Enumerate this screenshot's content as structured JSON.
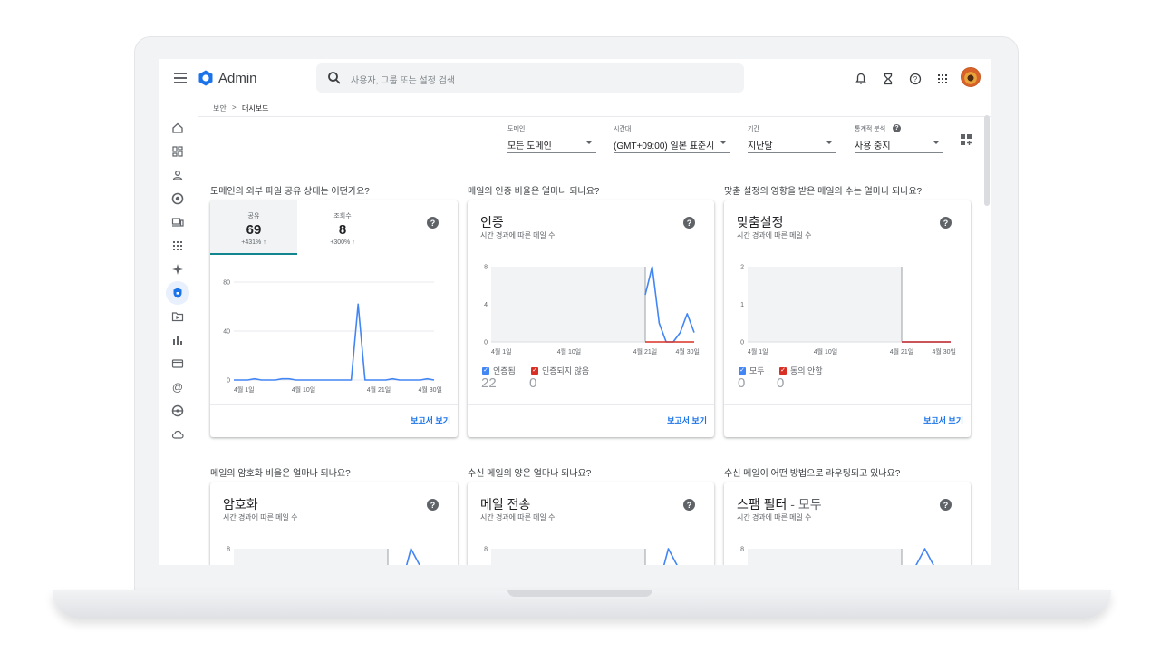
{
  "app": {
    "name": "Admin",
    "search_placeholder": "사용자, 그룹 또는 설정 검색"
  },
  "top_icons": [
    "bell-icon",
    "hourglass-icon",
    "help-icon",
    "apps-grid-icon"
  ],
  "breadcrumb": {
    "parent": "보안",
    "separator": ">",
    "current": "대시보드"
  },
  "filters": [
    {
      "label": "도메인",
      "value": "모든 도메인"
    },
    {
      "label": "시간대",
      "value": "(GMT+09:00) 일본 표준시"
    },
    {
      "label": "기간",
      "value": "지난달"
    },
    {
      "label": "통계적 분석",
      "value": "사용 중지"
    }
  ],
  "colors": {
    "accent": "#1a73e8",
    "line": "#4285f4",
    "red": "#d93025",
    "teal": "#12868f"
  },
  "cards": {
    "sharing": {
      "question": "도메인의 외부 파일 공유 상태는 어떤가요?",
      "tabs": [
        {
          "label": "공유",
          "value": "69",
          "change": "+431% ↑"
        },
        {
          "label": "조회수",
          "value": "8",
          "change": "+300% ↑"
        }
      ],
      "report_link": "보고서 보기"
    },
    "auth": {
      "question": "메일의 인증 비율은 얼마나 되나요?",
      "title": "인증",
      "subtitle": "시간 경과에 따른 메일 수",
      "legend": [
        {
          "label": "인증됨",
          "value": "22"
        },
        {
          "label": "인증되지 않음",
          "value": "0"
        }
      ],
      "report_link": "보고서 보기"
    },
    "custom": {
      "question": "맞춤 설정의 영향을 받은 메일의 수는 얼마나 되나요?",
      "title": "맞춤설정",
      "subtitle": "시간 경과에 따른 메일 수",
      "legend": [
        {
          "label": "모두",
          "value": "0"
        },
        {
          "label": "동의 안함",
          "value": "0"
        }
      ],
      "report_link": "보고서 보기"
    },
    "encryption": {
      "question": "메일의 암호화 비율은 얼마나 되나요?",
      "title": "암호화",
      "subtitle": "시간 경과에 따른 메일 수"
    },
    "volume": {
      "question": "수신 메일의 양은 얼마나 되나요?",
      "title": "메일 전송",
      "subtitle": "시간 경과에 따른 메일 수"
    },
    "routing": {
      "question": "수신 메일이 어떤 방법으로 라우팅되고 있나요?",
      "title": "스팸 필터",
      "title_suffix": " - 모두",
      "subtitle": "시간 경과에 따른 메일 수"
    }
  },
  "chart_data": [
    {
      "type": "line",
      "x": [
        "4월 1일",
        "4월 10일",
        "4월 21일",
        "4월 30일"
      ],
      "ylim": [
        0,
        80
      ],
      "yticks": [
        "0",
        "40",
        "80"
      ],
      "series": [
        {
          "values": [
            0,
            0,
            0,
            1,
            0,
            0,
            0,
            1,
            1,
            0,
            0,
            0,
            0,
            0,
            0,
            0,
            0,
            0,
            62,
            0,
            0,
            0,
            0,
            1,
            0,
            0,
            0,
            0,
            1,
            0
          ]
        }
      ]
    },
    {
      "type": "line",
      "x": [
        "4월 1일",
        "4월 10일",
        "4월 21일",
        "4월 30일"
      ],
      "ylim": [
        0,
        8
      ],
      "yticks": [
        "0",
        "4",
        "8"
      ],
      "series": [
        {
          "name": "인증됨",
          "values": [
            5,
            8,
            2,
            0,
            0,
            1,
            3,
            1
          ]
        },
        {
          "name": "인증되지 않음",
          "values": [
            0,
            0,
            0,
            0,
            0,
            0,
            0,
            0
          ]
        }
      ]
    },
    {
      "type": "line",
      "x": [
        "4월 1일",
        "4월 10일",
        "4월 21일",
        "4월 30일"
      ],
      "ylim": [
        0,
        2
      ],
      "yticks": [
        "0",
        "1",
        "2"
      ],
      "series": [
        {
          "name": "모두",
          "values": [
            0,
            0,
            0,
            0,
            0,
            0,
            0,
            0
          ]
        },
        {
          "name": "동의 안함",
          "values": [
            0,
            0,
            0,
            0,
            0,
            0,
            0,
            0
          ]
        }
      ]
    },
    {
      "type": "line",
      "yticks": [
        "8"
      ],
      "series": [
        {
          "values": [
            0,
            8,
            4
          ]
        }
      ]
    },
    {
      "type": "line",
      "yticks": [
        "8"
      ],
      "series": [
        {
          "values": [
            0,
            8,
            4
          ]
        }
      ]
    },
    {
      "type": "line",
      "yticks": [
        "8"
      ],
      "series": [
        {
          "values": [
            4,
            8,
            4
          ]
        }
      ]
    }
  ]
}
